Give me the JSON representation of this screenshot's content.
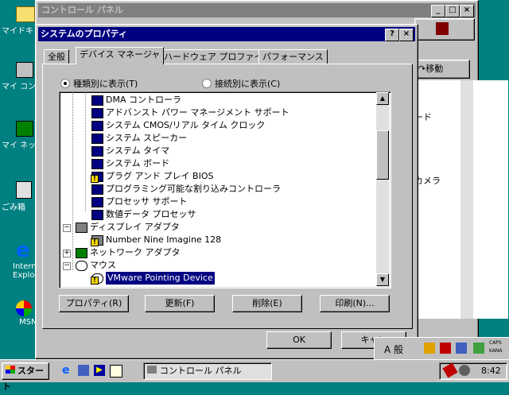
{
  "desktop": {
    "icons": [
      {
        "label": "マイドキ"
      },
      {
        "label": "マイ コンピ"
      },
      {
        "label": "マイ ネット"
      },
      {
        "label": "ごみ箱"
      },
      {
        "label": "Internet Explo"
      },
      {
        "label": "MSN"
      }
    ]
  },
  "control_panel": {
    "title": "コントロール パネル",
    "toolbar_move": "移動",
    "right_items": [
      "ード",
      "カメラ"
    ]
  },
  "dialog": {
    "title": "システムのプロパティ",
    "help_btn": "?",
    "close_btn": "×",
    "tabs": [
      "全般",
      "デバイス マネージャ",
      "ハードウェア プロファイル",
      "パフォーマンス"
    ],
    "radio_by_type": "種類別に表示(T)",
    "radio_by_connection": "接続別に表示(C)",
    "tree_items": [
      "DMA コントローラ",
      "アドバンスト パワー マネージメント サポート",
      "システム CMOS/リアル タイム クロック",
      "システム スピーカー",
      "システム タイマ",
      "システム ボード",
      "プラグ アンド プレイ BIOS",
      "プログラミング可能な割り込みコントローラ",
      "プロセッサ サポート",
      "数値データ プロセッサ",
      "ディスプレイ アダプタ",
      "Number Nine Imagine 128",
      "ネットワーク アダプタ",
      "マウス",
      "VMware Pointing Device"
    ],
    "buttons": {
      "properties": "プロパティ(R)",
      "refresh": "更新(F)",
      "remove": "削除(E)",
      "print": "印刷(N)..."
    },
    "ok": "OK",
    "cancel": "キャン"
  },
  "ime": {
    "mode": "A 般",
    "caps": "CAPS",
    "kana": "KANA"
  },
  "taskbar": {
    "start": "スタート",
    "task": "コントロール パネル",
    "clock": "8:42"
  }
}
